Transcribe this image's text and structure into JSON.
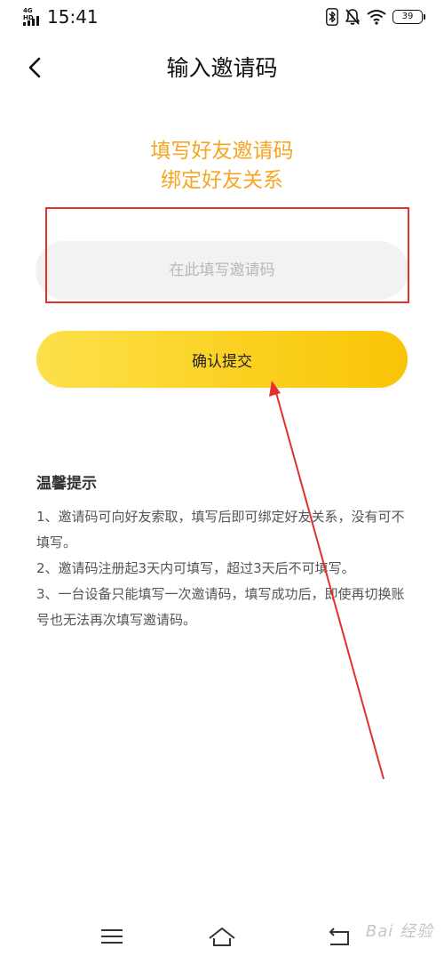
{
  "status_bar": {
    "network": "4G HD",
    "time": "15:41",
    "battery": "39"
  },
  "header": {
    "title": "输入邀请码"
  },
  "headline": {
    "line1": "填写好友邀请码",
    "line2": "绑定好友关系"
  },
  "form": {
    "placeholder": "在此填写邀请码",
    "value": "",
    "submit_label": "确认提交"
  },
  "tips": {
    "title": "温馨提示",
    "items": [
      "1、邀请码可向好友索取，填写后即可绑定好友关系，没有可不填写。",
      "2、邀请码注册起3天内可填写，超过3天后不可填写。",
      "3、一台设备只能填写一次邀请码，填写成功后，即使再切换账号也无法再次填写邀请码。"
    ]
  },
  "watermark": "Bai 经验",
  "colors": {
    "accent": "#f5a623",
    "button": "#fbd01e",
    "highlight": "#e03030"
  },
  "icons": {
    "back": "chevron-left-icon",
    "nav_menu": "menu-icon",
    "nav_home": "home-icon",
    "nav_back": "return-icon"
  }
}
